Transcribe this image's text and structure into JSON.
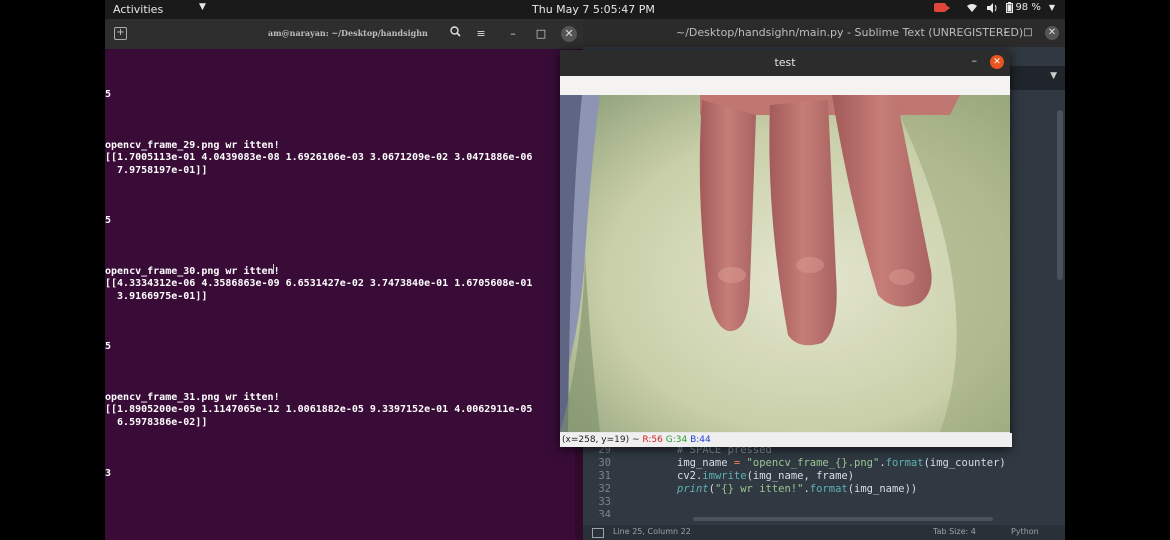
{
  "topbar": {
    "activities": "Activities",
    "clock": "Thu May 7  5:05:47 PM",
    "battery": "98 %"
  },
  "terminal": {
    "title": "am@narayan: ~/Desktop/handsighn",
    "lines": [
      "5",
      "opencv_frame_29.png wr itten!",
      "[[1.7005113e-01 4.0439083e-08 1.6926106e-03 3.0671209e-02 3.0471886e-06",
      "  7.9758197e-01]]",
      "5",
      "opencv_frame_30.png wr itten!",
      "[[4.3334312e-06 4.3586863e-09 6.6531427e-02 3.7473840e-01 1.6705608e-01",
      "  3.9166975e-01]]",
      "5",
      "opencv_frame_31.png wr itten!",
      "[[1.8905200e-09 1.1147065e-12 1.0061882e-05 9.3397152e-01 4.0062911e-05",
      "  6.5978386e-02]]",
      "3"
    ]
  },
  "sublime": {
    "title": "~/Desktop/handsighn/main.py - Sublime Text (UNREGISTERED)",
    "code": {
      "ln29": "29",
      "l29": "# SPACE pressed",
      "ln30": "30",
      "l30_a": "img_name ",
      "l30_op": "=",
      "l30_str": " \"opencv_frame_{}.png\"",
      "l30_b": ".",
      "l30_fn": "format",
      "l30_c": "(img_counter)",
      "ln31": "31",
      "l31_a": "cv2.",
      "l31_fn": "imwrite",
      "l31_b": "(img_name, frame)",
      "ln32": "32",
      "l32_print": "print",
      "l32_a": "(",
      "l32_str": "\"{} wr itten!\"",
      "l32_b": ".",
      "l32_fn": "format",
      "l32_c": "(img_name))",
      "ln33": "33",
      "ln34": "34"
    },
    "status": {
      "position": "Line 25, Column 22",
      "tab_size": "Tab Size: 4",
      "syntax": "Python"
    }
  },
  "test_window": {
    "title": "test",
    "status": {
      "coords": "(x=258, y=19) ~ ",
      "r": "R:56",
      "g": "G:34",
      "b": "B:44"
    }
  },
  "colors": {
    "terminal_bg": "#380c37",
    "ubuntu_orange": "#e95420",
    "sublime_bg": "#303841"
  }
}
